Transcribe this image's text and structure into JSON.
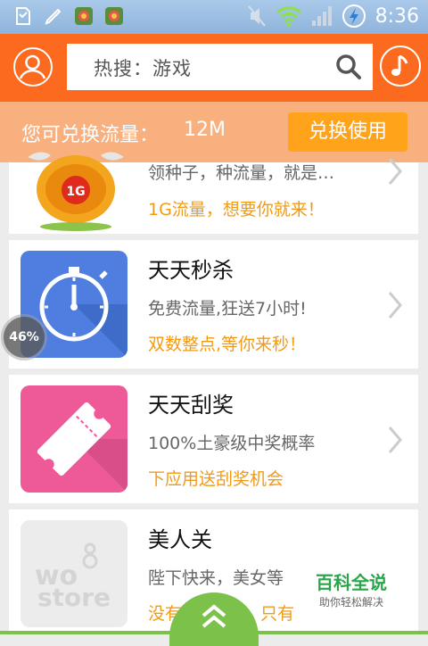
{
  "status_bar": {
    "time": "8:36"
  },
  "header": {
    "search_text": "热搜：游戏"
  },
  "exchange": {
    "label": "您可兑换流量：",
    "amount": "12M",
    "button_label": "兑换使用"
  },
  "items": [
    {
      "title": "",
      "subtitle": "领种子，种流量，就是…",
      "promo": "1G流量，想要你就来！",
      "icon_text": "1G"
    },
    {
      "title": "天天秒杀",
      "subtitle": "免费流量,狂送7小时!",
      "promo": "双数整点,等你来秒！"
    },
    {
      "title": "天天刮奖",
      "subtitle": "100%土豪级中奖概率",
      "promo": "下应用送刮奖机会"
    },
    {
      "title": "美人关",
      "subtitle": "陛下快来，美女等",
      "promo": "没有7万火海，只有",
      "icon_text_1": "wo",
      "icon_text_2": "store"
    }
  ],
  "download_progress": "46%",
  "watermark": {
    "main": "百科全说",
    "sub": "助你轻松解决"
  },
  "colors": {
    "header": "#fb6a1f",
    "promo": "#f39a14",
    "exchange_button": "#ffa31a",
    "green": "#7cc24a"
  }
}
